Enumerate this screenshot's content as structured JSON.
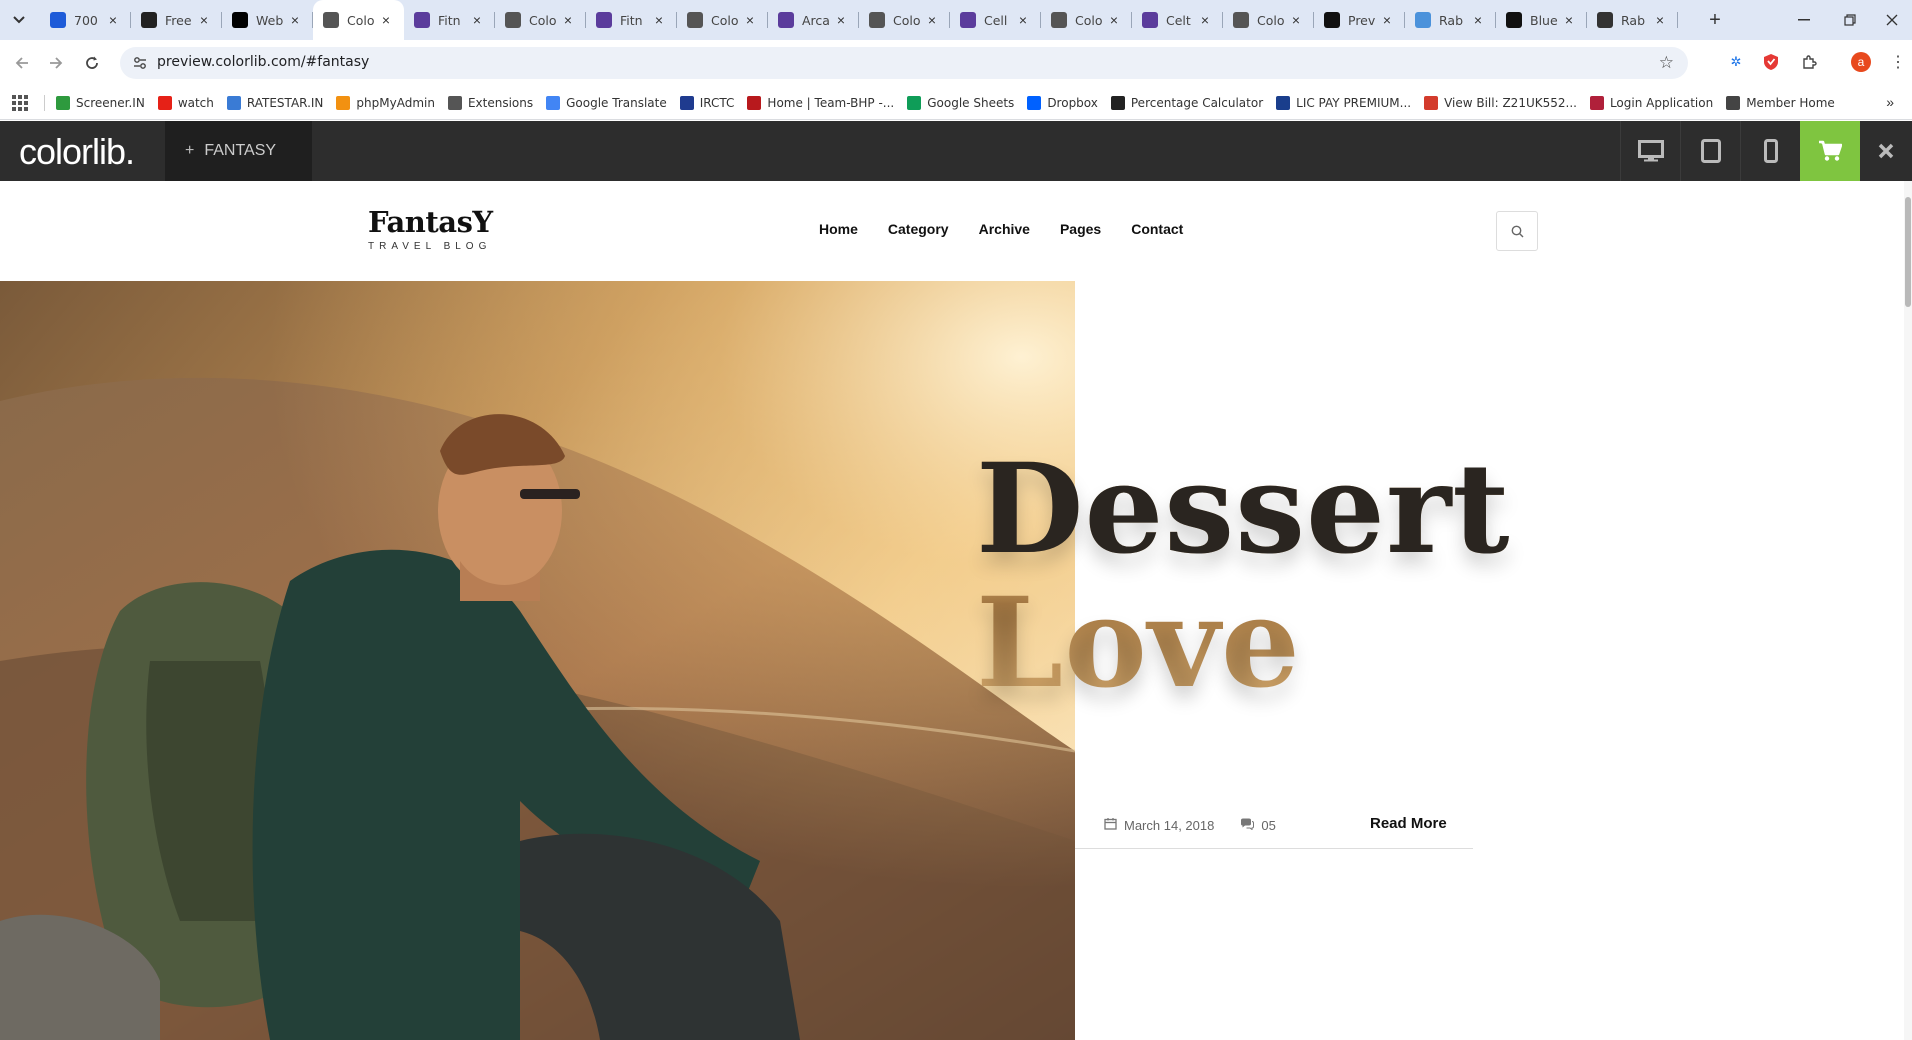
{
  "browser": {
    "tabs": [
      {
        "title": "700",
        "icon": "word-icon",
        "color": "#1e5bd8"
      },
      {
        "title": "Free",
        "icon": "flag-icon",
        "color": "#222222"
      },
      {
        "title": "Web",
        "icon": "wix-icon",
        "color": "#000000"
      },
      {
        "title": "Colo",
        "icon": "globe-icon",
        "color": "#555555",
        "active": true
      },
      {
        "title": "Fitn",
        "icon": "colorlib-icon",
        "color": "#5b3c9c"
      },
      {
        "title": "Colo",
        "icon": "globe-icon",
        "color": "#555555"
      },
      {
        "title": "Fitn",
        "icon": "colorlib-icon",
        "color": "#5b3c9c"
      },
      {
        "title": "Colo",
        "icon": "globe-icon",
        "color": "#555555"
      },
      {
        "title": "Arca",
        "icon": "colorlib-icon",
        "color": "#5b3c9c"
      },
      {
        "title": "Colo",
        "icon": "globe-icon",
        "color": "#555555"
      },
      {
        "title": "Cell",
        "icon": "colorlib-icon",
        "color": "#5b3c9c"
      },
      {
        "title": "Colo",
        "icon": "globe-icon",
        "color": "#555555"
      },
      {
        "title": "Celt",
        "icon": "colorlib-icon",
        "color": "#5b3c9c"
      },
      {
        "title": "Colo",
        "icon": "globe-icon",
        "color": "#555555"
      },
      {
        "title": "Prev",
        "icon": "wikipedia-icon",
        "color": "#111111"
      },
      {
        "title": "Rab",
        "icon": "un-icon",
        "color": "#4b92db"
      },
      {
        "title": "Blue",
        "icon": "wikipedia-icon",
        "color": "#111111"
      },
      {
        "title": "Rab",
        "icon": "chatgpt-icon",
        "color": "#333333"
      }
    ],
    "url": "preview.colorlib.com/#fantasy",
    "profile_initial": "a"
  },
  "bookmarks": [
    {
      "label": "Screener.IN",
      "color": "#2e9a3e"
    },
    {
      "label": "watch",
      "color": "#e62117"
    },
    {
      "label": "RATESTAR.IN",
      "color": "#3a7bd5"
    },
    {
      "label": "phpMyAdmin",
      "color": "#f29111"
    },
    {
      "label": "Extensions",
      "color": "#555555"
    },
    {
      "label": "Google Translate",
      "color": "#4285f4"
    },
    {
      "label": "IRCTC",
      "color": "#1f3b8f"
    },
    {
      "label": "Home | Team-BHP -...",
      "color": "#b8191d"
    },
    {
      "label": "Google Sheets",
      "color": "#0f9d58"
    },
    {
      "label": "Dropbox",
      "color": "#0061ff"
    },
    {
      "label": "Percentage Calculator",
      "color": "#222222"
    },
    {
      "label": "LIC PAY PREMIUM...",
      "color": "#1a3e8c"
    },
    {
      "label": "View Bill: Z21UK552...",
      "color": "#d33b2c"
    },
    {
      "label": "Login Application",
      "color": "#b0203a"
    },
    {
      "label": "Member Home",
      "color": "#444444"
    }
  ],
  "colorlib": {
    "logo": "colorlib.",
    "theme_name": "FANTASY",
    "theme_plus": "+"
  },
  "site": {
    "logo_name": "FantasY",
    "logo_tagline": "TRAVEL BLOG",
    "nav": [
      "Home",
      "Category",
      "Archive",
      "Pages",
      "Contact"
    ],
    "hero": {
      "title_line1": "Dessert",
      "title_line2": "Love",
      "date": "March 14, 2018",
      "comments": "05",
      "read_more": "Read More"
    }
  }
}
